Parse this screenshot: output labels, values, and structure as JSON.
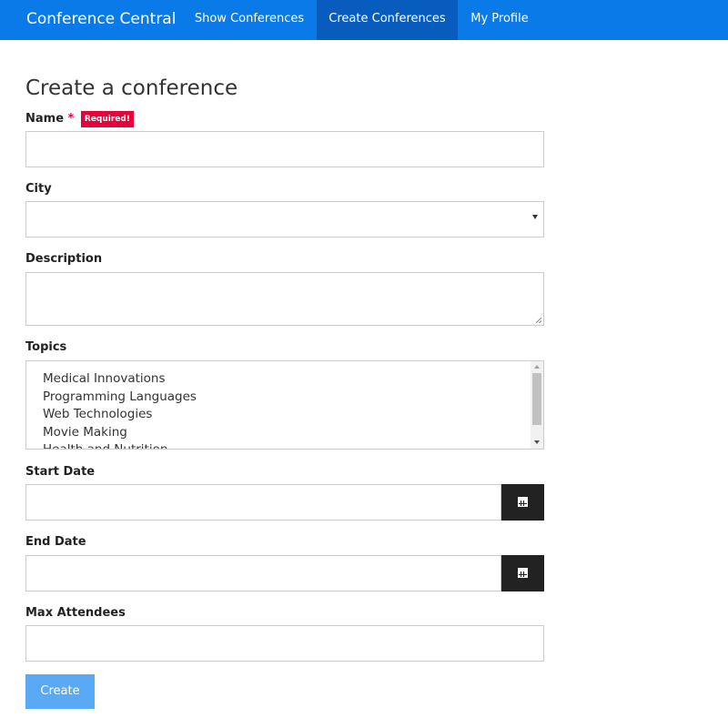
{
  "navbar": {
    "brand": "Conference Central",
    "links": [
      "Show Conferences",
      "Create Conferences",
      "My Profile"
    ],
    "active_index": 1,
    "color": "#0a7ae8",
    "active_color": "#075cbd"
  },
  "form": {
    "title": "Create a conference",
    "name": {
      "label": "Name",
      "required_mark": "*",
      "required_badge": "Required!",
      "value": ""
    },
    "city": {
      "label": "City",
      "selected": ""
    },
    "description": {
      "label": "Description",
      "value": ""
    },
    "topics": {
      "label": "Topics",
      "options": [
        "Medical Innovations",
        "Programming Languages",
        "Web Technologies",
        "Movie Making",
        "Health and Nutrition"
      ]
    },
    "start_date": {
      "label": "Start Date",
      "value": "",
      "button_icon": "calendar-icon"
    },
    "end_date": {
      "label": "End Date",
      "value": "",
      "button_icon": "calendar-icon"
    },
    "max_attendees": {
      "label": "Max Attendees",
      "value": ""
    },
    "submit": {
      "label": "Create",
      "disabled": true,
      "color": "#5aa9f5"
    }
  }
}
